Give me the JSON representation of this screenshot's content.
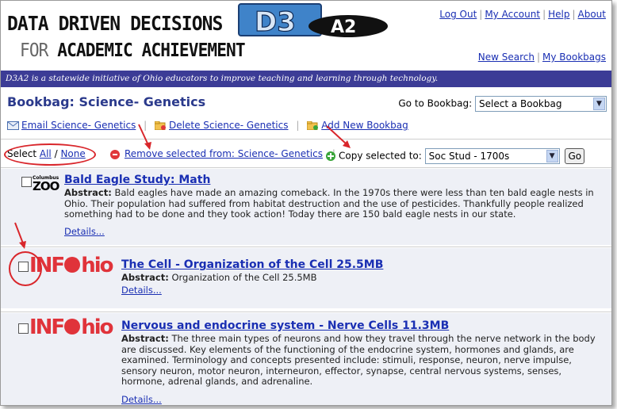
{
  "header": {
    "title_line1": "DATA DRIVEN DECISIONS",
    "title_line2_light": "FOR ",
    "title_line2_bold": "ACADEMIC ACHIEVEMENT",
    "logo_text_main": "D3",
    "logo_text_sub": "A2",
    "top_links": [
      "Log Out",
      "My Account",
      "Help",
      "About"
    ],
    "sub_links": [
      "New Search",
      "My Bookbags"
    ]
  },
  "banner": "D3A2 is a statewide initiative of Ohio educators to improve teaching and learning through technology.",
  "bookbag": {
    "title": "Bookbag: Science- Genetics",
    "goto_label": "Go to Bookbag:",
    "goto_value": "Select a Bookbag",
    "email_link": "Email Science- Genetics",
    "delete_link": "Delete Science- Genetics",
    "add_link": "Add New Bookbag"
  },
  "selection": {
    "select_label": "Select",
    "all": "All",
    "slash": "/",
    "none": "None",
    "remove": "Remove selected from: Science- Genetics",
    "copy_label": "Copy selected to:",
    "copy_value": "Soc Stud - 1700s",
    "go": "Go"
  },
  "items": [
    {
      "source": "Columbus Zoo and Aquarium",
      "logo_zoo_top": "Columbus",
      "logo_zoo_main": "ZOO",
      "title": "Bald Eagle Study: Math",
      "abstract_label": "Abstract:",
      "abstract": "Bald eagles have made an amazing comeback. In the 1970s there were less than ten bald eagle nests in Ohio. Their population had suffered from habitat destruction and the use of pesticides. Thankfully people realized something had to be done and they took action! Today there are 150 bald eagle nests in our state.",
      "details": "Details..."
    },
    {
      "source": "INFOhio",
      "logo_info_a": "INF",
      "logo_info_b": "hio",
      "title": "The Cell - Organization of the Cell 25.5MB",
      "abstract_label": "Abstract:",
      "abstract": "Organization of the Cell 25.5MB",
      "details": "Details..."
    },
    {
      "source": "INFOhio",
      "logo_info_a": "INF",
      "logo_info_b": "hio",
      "title": "Nervous and endocrine system - Nerve Cells 11.3MB",
      "abstract_label": "Abstract:",
      "abstract": "The three main types of neurons and how they travel through the nerve network in the body are discussed. Key elements of the functioning of the endocrine system, hormones and glands, are examined. Terminology and concepts presented include: stimuli, response, neuron, nerve impulse, sensory neuron, motor neuron, interneuron, effector, synapse, central nervous systems, senses, hormone, adrenal glands, and adrenaline.",
      "details": "Details..."
    }
  ],
  "colors": {
    "banner_bg": "#3c3c96",
    "link": "#1a2fb3",
    "annotation_red": "#d9262b",
    "item_bg": "#eef0f6",
    "bookbag_title": "#2b3a8c"
  }
}
